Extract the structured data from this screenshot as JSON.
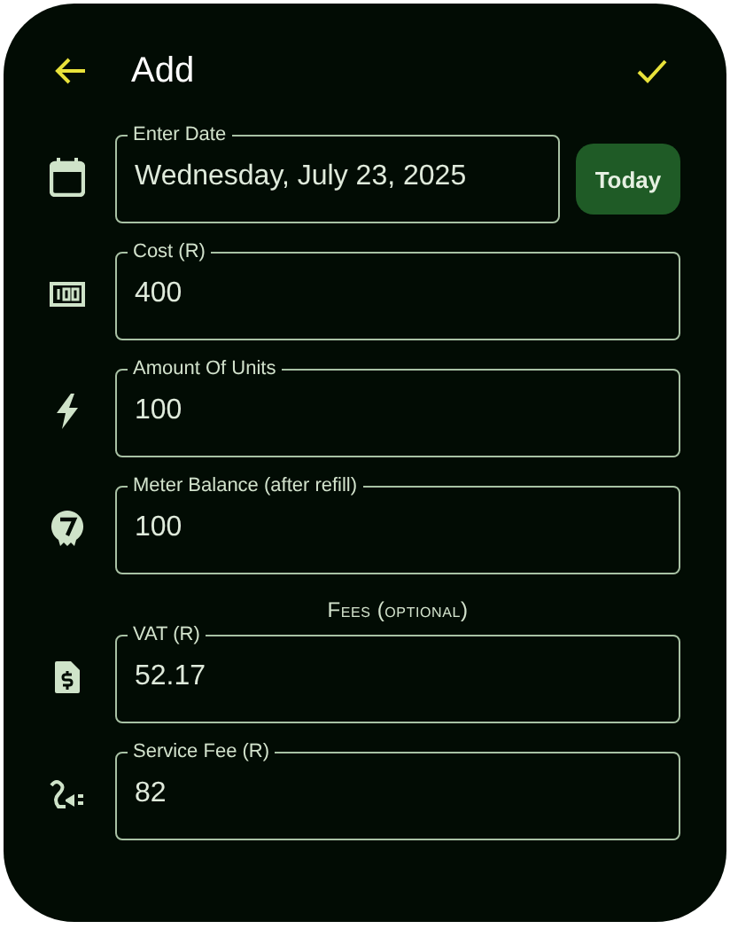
{
  "app_bar": {
    "title": "Add"
  },
  "fields": [
    {
      "kind": "date",
      "label": "Enter Date",
      "value": "Wednesday, July 23, 2025",
      "button": "Today"
    },
    {
      "kind": "cost",
      "label": "Cost (R)",
      "value": "400"
    },
    {
      "kind": "units",
      "label": "Amount Of Units",
      "value": "100"
    },
    {
      "kind": "meter",
      "label": "Meter Balance (after refill)",
      "value": "100"
    }
  ],
  "fees_section": {
    "heading": "Fees (optional)",
    "fields": [
      {
        "kind": "vat",
        "label": "VAT (R)",
        "value": "52.17"
      },
      {
        "kind": "service",
        "label": "Service Fee (R)",
        "value": "82"
      }
    ]
  }
}
